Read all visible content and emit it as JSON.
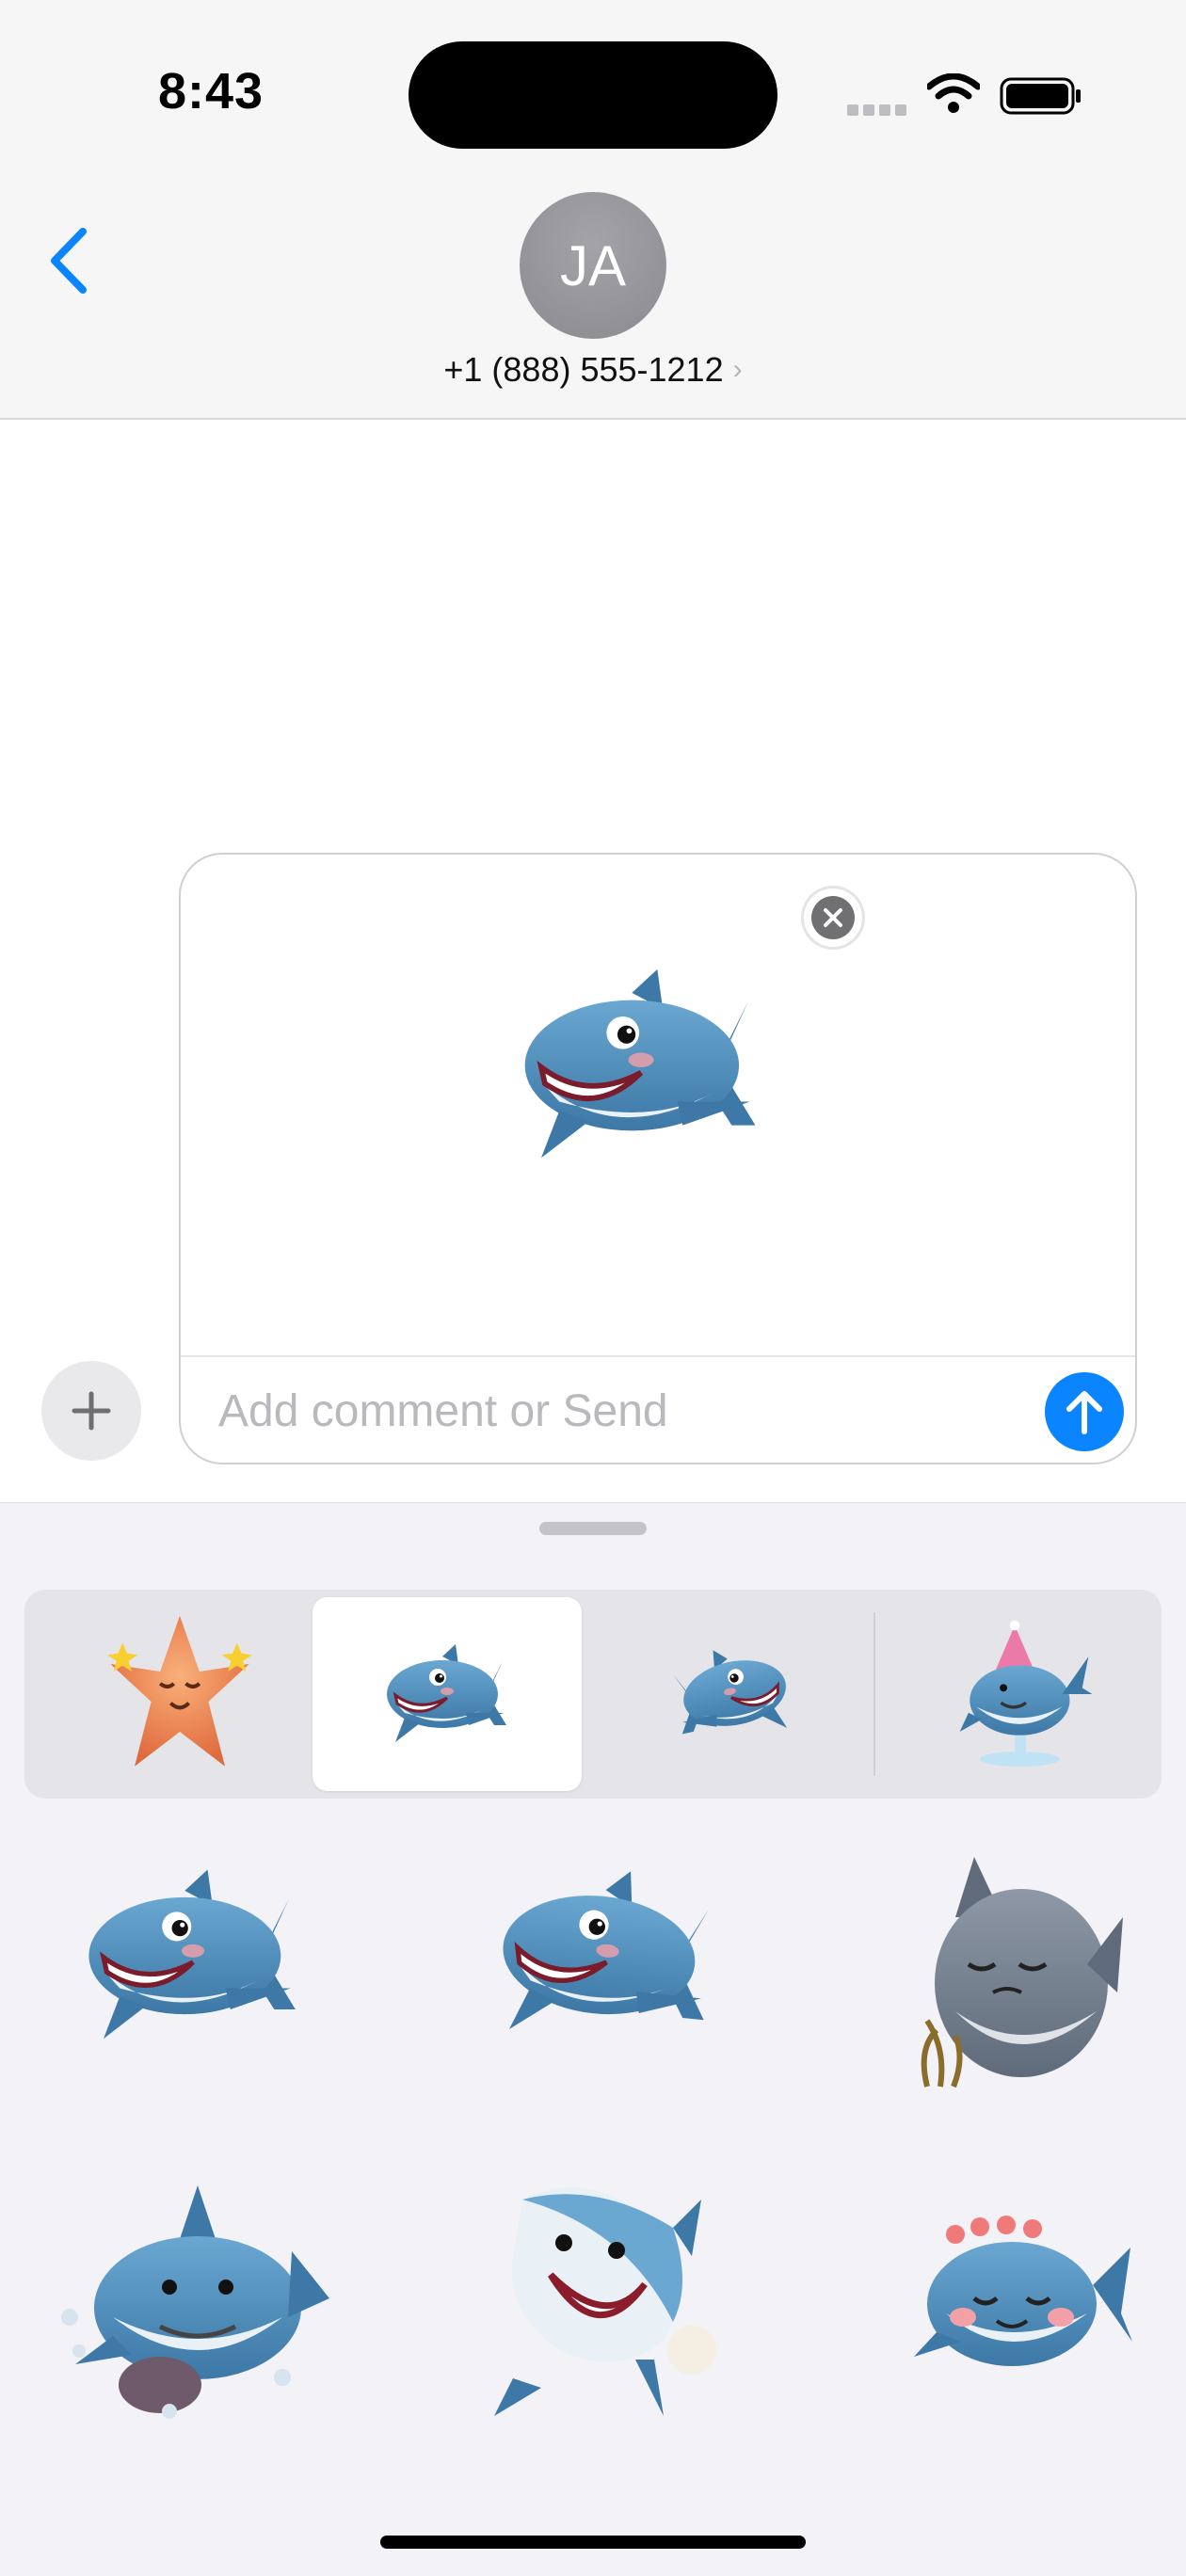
{
  "status_bar": {
    "time": "8:43"
  },
  "header": {
    "avatar_initials": "JA",
    "contact": "+1 (888) 555-1212",
    "contact_chevron": "›"
  },
  "compose": {
    "placeholder": "Add comment or Send",
    "preview_sticker": "shark-pearls-sticker"
  },
  "sticker_bar": {
    "items": [
      {
        "sticker": "starfish-sticker",
        "selected": false
      },
      {
        "sticker": "shark-pearls-sticker",
        "selected": true
      },
      {
        "sticker": "shark-swimming-sticker",
        "selected": false
      },
      {
        "sticker": "whale-party-hat-sticker",
        "selected": false
      }
    ]
  },
  "sticker_grid": [
    "shark-pearls-sticker",
    "shark-grinning-sticker",
    "shark-sad-seaweed-sticker",
    "shark-bubbles-sticker",
    "shark-pearl-sticker",
    "shark-flower-crown-sticker"
  ],
  "colors": {
    "accent": "#0a84ff",
    "shark_blue": "#4f89b3",
    "shark_belly": "#eaf1f6",
    "starfish": "#f08a4b"
  }
}
